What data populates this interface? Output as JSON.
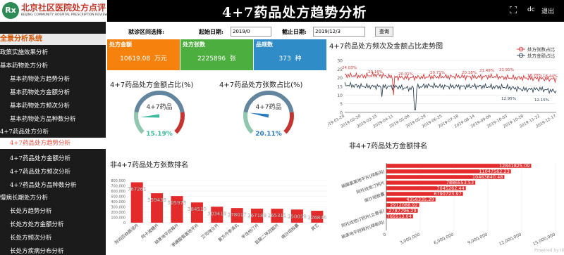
{
  "header": {
    "logo_mark": "Rx",
    "logo_title": "北京社区医院处方点评",
    "logo_subtitle": "BEIJING COMMUNITY HOSPITAL PRESCRIPTION REVIEW",
    "title": "4+7药品处方趋势分析",
    "user": "dc",
    "logout": "退出"
  },
  "sidebar": {
    "header": "全景分析系统",
    "items": [
      {
        "label": "政策实施效果分析",
        "selected": false
      },
      {
        "label": "基本药物处方分析",
        "selected": false
      },
      {
        "label": "基本药物处方趋势分析",
        "selected": false
      },
      {
        "label": "基本药物处方金额分析",
        "selected": false
      },
      {
        "label": "基本药物处方频次分析",
        "selected": false
      },
      {
        "label": "基本药物处方品种数分析",
        "selected": false
      },
      {
        "label": "4+7药品处方分析",
        "selected": false
      },
      {
        "label": "4+7药品处方趋势分析",
        "selected": true
      },
      {
        "label": "4+7药品处方金额分析",
        "selected": false
      },
      {
        "label": "4+7药品处方频次分析",
        "selected": false
      },
      {
        "label": "4+7药品处方品种数分析",
        "selected": false
      },
      {
        "label": "慢病长期处方分析",
        "selected": false
      },
      {
        "label": "长处方趋势分析",
        "selected": false
      },
      {
        "label": "长处方处方金额分析",
        "selected": false
      },
      {
        "label": "长处方频次分析",
        "selected": false
      },
      {
        "label": "长处方疾病分布分析",
        "selected": false
      }
    ]
  },
  "filter": {
    "region_label": "就诊区间选择:",
    "start_label": "起始日期:",
    "start_value": "2019/0",
    "end_label": "截止日期:",
    "end_value": "2019/12/3",
    "query_button": "查询"
  },
  "kpis": [
    {
      "label": "处方金额",
      "value": "10619.08",
      "unit": "万元",
      "color": "#f5820d"
    },
    {
      "label": "处方张数",
      "value": "2225896",
      "unit": "张",
      "color": "#4cae3e"
    },
    {
      "label": "品规数",
      "value": "373",
      "unit": "种",
      "color": "#2f8cc7"
    }
  ],
  "gauges": {
    "amount": {
      "title": "4+7药品处方金额占比(%)",
      "name": "4+7药品",
      "value": 15.19,
      "value_text": "15.19%",
      "value_color": "#3dbb9c"
    },
    "count": {
      "title": "4+7药品处方张数占比(%)",
      "name": "4+7药品",
      "value": 20.11,
      "value_text": "20.11%",
      "value_color": "#2b7bc0"
    }
  },
  "chart_data": [
    {
      "id": "trend",
      "type": "line",
      "title": "4+7药品处方频次及金额占比走势图",
      "x": [
        "2019-01-28",
        "2019-02-20",
        "2019-03-15",
        "2019-04-11",
        "2019-05-06",
        "2019-05-29",
        "2019-06-25",
        "2019-07-18",
        "2019-08-14",
        "2019-09-06",
        "2019-10-03",
        "2019-10-28",
        "2019-11-22",
        "2019-12-17"
      ],
      "ylim": [
        0,
        30
      ],
      "yticks": [
        "0",
        "5",
        "10",
        "15",
        "20",
        "25",
        "30"
      ],
      "series": [
        {
          "name": "处方张数占比",
          "color": "#d63a3a",
          "values": [
            21.5,
            20.9,
            21.7,
            20.3,
            20.0,
            20.5,
            20.6,
            20.7,
            20.4,
            20.8,
            20.0,
            19.9,
            19.5,
            19.1
          ]
        },
        {
          "name": "处方金额占比",
          "color": "#2f4554",
          "values": [
            15.9,
            15.1,
            14.9,
            14.9,
            13.8,
            15.4,
            15.0,
            14.9,
            15.1,
            14.8,
            14.5,
            13.2,
            13.5,
            12.1
          ]
        }
      ],
      "labels_top": [
        "24.03%",
        "20.16%",
        "20.01%",
        "20.71%",
        "20.18%",
        "21.49%",
        "21.91%",
        "18.78%",
        "18.44%"
      ],
      "labels_bottom": [
        "12.95%",
        "12.15%"
      ]
    },
    {
      "id": "count_rank",
      "type": "bar",
      "title": "非4+7药品处方张数排名",
      "categories": [
        "阿司匹林肠溶片",
        "阿卡波糖片",
        "硝苯地平控释片",
        "苯磺酸氨氯地平片",
        "艾司唑仑片",
        "复方丹参滴丸",
        "辛伐他汀片",
        "盐酸二甲双胍片",
        "缬沙坦胶囊",
        "其它"
      ],
      "values": [
        767,
        559,
        505,
        384,
        303,
        278,
        267,
        265,
        250,
        226
      ],
      "value_labels": [
        "767261",
        "559438",
        "505975",
        "384510",
        "303418",
        "278017",
        "267188",
        "265311",
        "250059",
        "226846"
      ],
      "ylim": [
        0,
        800
      ],
      "yticks": [
        "0",
        "100,000",
        "200,000",
        "300,000",
        "400,000",
        "500,000",
        "600,000",
        "700,000",
        "800,000"
      ]
    },
    {
      "id": "amount_rank",
      "type": "bar",
      "orientation": "horizontal",
      "title": "非4+7药品处方金额排名",
      "categories": [
        "",
        "硝酸氯氯地平片(拜新同)",
        "",
        "阿托伐他汀钙片",
        "",
        "缬沙坦胶囊",
        "",
        "",
        "阿托伐他汀钙片(立普妥)",
        "",
        "硝苯地平控释片(拜新同)",
        ""
      ],
      "values": [
        12841825.09,
        11047562.23,
        10463840.48,
        7886553.53,
        7045262.44,
        6790723.97,
        4356335.29,
        2912088.92,
        2787796.29,
        2365513.04,
        0,
        0
      ],
      "value_labels": [
        "12841825.09",
        "11047562.23",
        "10463840.48",
        "7886553.53",
        "7045262.44",
        "6790723.97",
        "4356335.29",
        "2912088.92",
        "2787796.29",
        "2765513.04",
        "",
        ""
      ],
      "xlim": [
        0,
        15000000
      ],
      "xticks": [
        "0",
        "3,000,000",
        "6,000,000",
        "9,000,000",
        "12,000,000",
        "15,000,000"
      ]
    }
  ],
  "footer": {
    "watermark": "Powered by III"
  }
}
